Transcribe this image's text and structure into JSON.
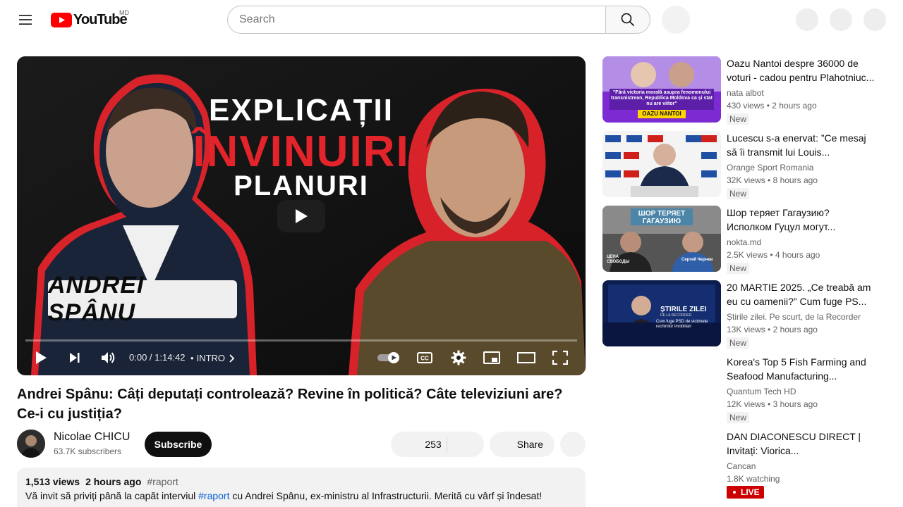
{
  "header": {
    "logo_text": "YouTube",
    "country_code": "MD",
    "search_placeholder": "Search"
  },
  "player": {
    "thumbnail": {
      "line1": "EXPLICAȚII",
      "line2": "ÎNVINUIRI",
      "line3": "PLANURI",
      "name_plate": "ANDREI SPÂNU"
    },
    "time_display": "0:00 / 1:14:42",
    "chapter_separator": "•",
    "chapter": "INTRO",
    "progress_fraction": 0.0
  },
  "video": {
    "title": "Andrei Spânu: Câți deputați controlează? Revine în politică? Câte televiziuni are? Ce-i cu justiția?",
    "channel": "Nicolae CHICU",
    "subscribers": "63.7K subscribers",
    "subscribe_label": "Subscribe",
    "likes": "253",
    "share_label": "Share"
  },
  "description": {
    "views": "1,513 views",
    "age": "2 hours ago",
    "hashtag": "#raport",
    "text_before": "Vă invit să priviți până la capăt interviul ",
    "text_link": "#raport",
    "text_after": " cu Andrei Spânu, ex-ministru al Infrastructurii.  Merită cu vârf și îndesat!"
  },
  "recommendations": [
    {
      "title": "Oazu Nantoi despre 36000 de voturi - cadou pentru Plahotniuc...",
      "channel": "nata albot",
      "views": "430 views",
      "age": "2 hours ago",
      "badge": "New",
      "thumb_text": "\"Fără victoria morală asupra fenomenului transnistrean, Republica Moldova ca și stat nu are viitor\"",
      "thumb_label": "OAZU NANTOI"
    },
    {
      "title": "Lucescu s-a enervat: ”Ce mesaj să îi transmit lui Louis...",
      "channel": "Orange Sport Romania",
      "views": "32K views",
      "age": "8 hours ago",
      "badge": "New"
    },
    {
      "title": "Шор теряет Гагаузию? Исполком Гуцул могут...",
      "channel": "nokta.md",
      "views": "2.5K views",
      "age": "4 hours ago",
      "badge": "New",
      "thumb_text": "ШОР ТЕРЯЕТ ГАГАУЗИЮ",
      "thumb_left": "ЦЕНА СВОБОДЫ",
      "thumb_right": "Сергей Чернев"
    },
    {
      "title": "20 MARTIE 2025. „Ce treabă am eu cu oamenii?” Cum fuge PS...",
      "channel": "Știrile zilei. Pe scurt, de la Recorder",
      "views": "13K views",
      "age": "2 hours ago",
      "badge": "New",
      "thumb_text": "ȘTIRILE ZILEI",
      "thumb_sub": "DE LA RECORDER",
      "thumb_caption": "Cum fuge PSD de victimele rechinilor imobiliari"
    },
    {
      "title": "Korea's Top 5 Fish Farming and Seafood Manufacturing...",
      "channel": "Quantum Tech HD",
      "views": "12K views",
      "age": "3 hours ago",
      "badge": "New"
    },
    {
      "title": "DAN DIACONESCU DIRECT | Invitați: Viorica...",
      "channel": "Cancan",
      "views": "1.8K watching",
      "badge": "LIVE"
    }
  ],
  "colors": {
    "brand_red": "#ff0000",
    "link_blue": "#065fd4",
    "live_red": "#cc0000"
  }
}
